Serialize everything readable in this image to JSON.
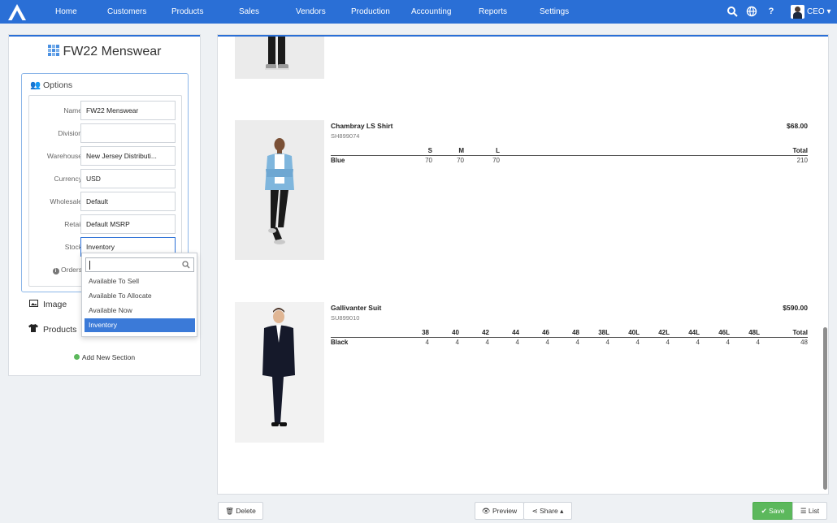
{
  "nav": {
    "items": [
      {
        "label": "Home"
      },
      {
        "label": "Customers"
      },
      {
        "label": "Products"
      },
      {
        "label": "Sales"
      },
      {
        "label": "Vendors"
      },
      {
        "label": "Production"
      },
      {
        "label": "Accounting"
      },
      {
        "label": "Reports"
      },
      {
        "label": "Settings"
      }
    ],
    "icons": [
      "search-icon",
      "globe-icon",
      "help-icon"
    ],
    "user_label": "CEO",
    "accent_color": "#2a6fd6"
  },
  "sidebar": {
    "title": "FW22 Menswear",
    "options_heading": "Options",
    "fields": [
      {
        "label": "Name",
        "value": "FW22 Menswear"
      },
      {
        "label": "Division",
        "value": ""
      },
      {
        "label": "Warehouse",
        "value": "New Jersey Distributi..."
      },
      {
        "label": "Currency",
        "value": "USD"
      },
      {
        "label": "Wholesale",
        "value": "Default"
      },
      {
        "label": "Retail",
        "value": "Default MSRP"
      },
      {
        "label": "Stock",
        "value": "Inventory"
      }
    ],
    "orders_label": "Orders",
    "sections": [
      {
        "label": "Image"
      },
      {
        "label": "Products"
      }
    ],
    "add_section_label": "Add New Section"
  },
  "stock_dropdown": {
    "search_value": "",
    "options": [
      {
        "label": "Available To Sell"
      },
      {
        "label": "Available To Allocate"
      },
      {
        "label": "Available Now"
      },
      {
        "label": "Inventory"
      }
    ],
    "selected": "Inventory"
  },
  "products": [
    {
      "name": "Chambray LS Shirt",
      "sku": "SH899074",
      "price": "$68.00",
      "sizes": [
        "S",
        "M",
        "L"
      ],
      "total_label": "Total",
      "rows": [
        {
          "color": "Blue",
          "qty": [
            "70",
            "70",
            "70"
          ],
          "total": "210"
        }
      ]
    },
    {
      "name": "Gallivanter Suit",
      "sku": "SU899010",
      "price": "$590.00",
      "sizes": [
        "38",
        "40",
        "42",
        "44",
        "46",
        "48",
        "38L",
        "40L",
        "42L",
        "44L",
        "46L",
        "48L"
      ],
      "total_label": "Total",
      "rows": [
        {
          "color": "Black",
          "qty": [
            "4",
            "4",
            "4",
            "4",
            "4",
            "4",
            "4",
            "4",
            "4",
            "4",
            "4",
            "4"
          ],
          "total": "48"
        }
      ]
    }
  ],
  "footer": {
    "delete_label": "Delete",
    "preview_label": "Preview",
    "share_label": "Share",
    "save_label": "Save",
    "list_label": "List"
  }
}
